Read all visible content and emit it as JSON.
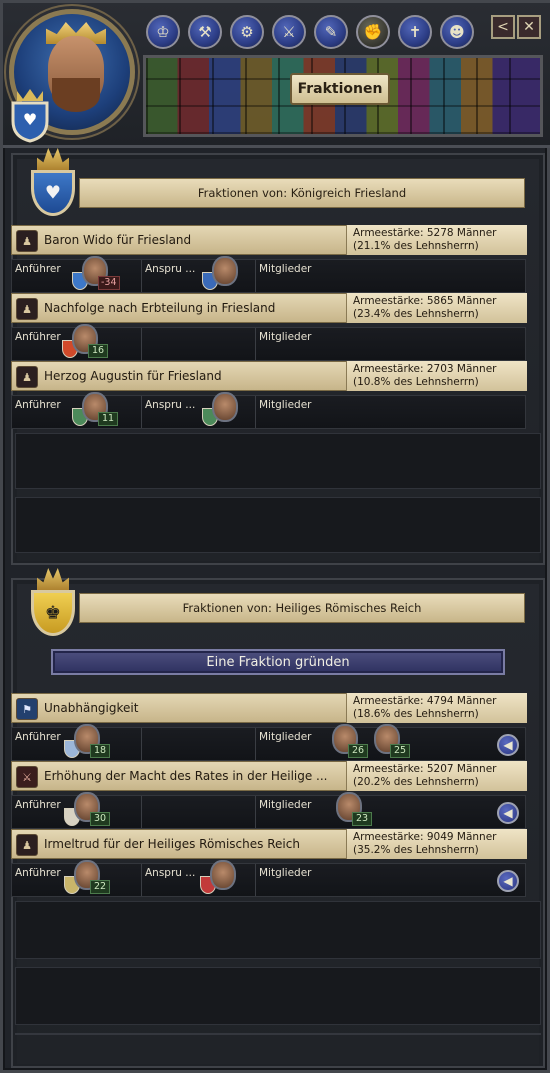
{
  "header": {
    "title": "Fraktionen",
    "nav_icons": [
      "crown-icon",
      "hammer-icon",
      "gear-icon",
      "sword-icon",
      "quill-icon",
      "factions-icon",
      "cross-icon",
      "people-icon"
    ],
    "back_label": "<",
    "close_label": "✕"
  },
  "sections": [
    {
      "title": "Fraktionen von: Königreich Friesland",
      "factions": [
        {
          "name": "Baron Wido für Friesland",
          "strength_line1": "Armeestärke: 5278 Männer",
          "strength_line2": "(21.1% des Lehnsherrn)",
          "leader_label": "Anführer",
          "leader_value": "-34",
          "claimant_label": "Anspru ...",
          "members_label": "Mitglieder"
        },
        {
          "name": "Nachfolge nach Erbteilung in Friesland",
          "strength_line1": "Armeestärke: 5865 Männer",
          "strength_line2": "(23.4% des Lehnsherrn)",
          "leader_label": "Anführer",
          "leader_value": "16",
          "members_label": "Mitglieder"
        },
        {
          "name": "Herzog Augustin für Friesland",
          "strength_line1": "Armeestärke: 2703 Männer",
          "strength_line2": "(10.8% des Lehnsherrn)",
          "leader_label": "Anführer",
          "leader_value": "11",
          "claimant_label": "Anspru ...",
          "members_label": "Mitglieder"
        }
      ]
    },
    {
      "title": "Fraktionen von: Heiliges Römisches Reich",
      "create_button": "Eine Fraktion gründen",
      "factions": [
        {
          "name": "Unabhängigkeit",
          "strength_line1": "Armeestärke: 4794 Männer",
          "strength_line2": "(18.6% des Lehnsherrn)",
          "leader_label": "Anführer",
          "leader_value": "18",
          "members_label": "Mitglieder",
          "member_values": [
            "26",
            "25"
          ]
        },
        {
          "name": "Erhöhung der Macht des Rates in der Heilige ...",
          "strength_line1": "Armeestärke: 5207 Männer",
          "strength_line2": "(20.2% des Lehnsherrn)",
          "leader_label": "Anführer",
          "leader_value": "30",
          "members_label": "Mitglieder",
          "member_values": [
            "23"
          ]
        },
        {
          "name": "Irmeltrud für der Heiliges Römisches Reich",
          "strength_line1": "Armeestärke: 9049 Männer",
          "strength_line2": "(35.2% des Lehnsherrn)",
          "leader_label": "Anführer",
          "leader_value": "22",
          "claimant_label": "Anspru ...",
          "members_label": "Mitglieder"
        }
      ]
    }
  ],
  "colors": {
    "banner": "#d9caa2",
    "nav_blue": "#3246a0",
    "number_green": "#1f3a1f",
    "number_red": "#3a1a1a"
  }
}
